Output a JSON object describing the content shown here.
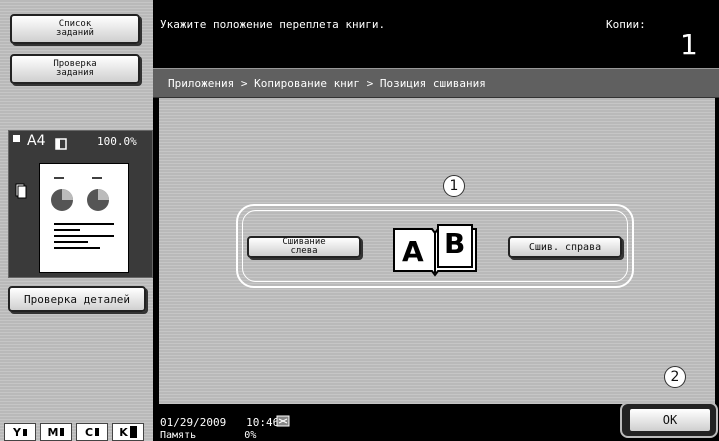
{
  "sidebar": {
    "job_list_label": "Список\nзаданий",
    "job_check_label": "Проверка\nзадания",
    "preview": {
      "paper": "A4",
      "zoom": "100.0%"
    },
    "check_details_label": "Проверка деталей",
    "toner": [
      "Y",
      "M",
      "C",
      "K"
    ],
    "toner_levels": [
      0.3,
      0.4,
      0.35,
      0.8
    ]
  },
  "header": {
    "message": "Укажите положение переплета книги.",
    "copies_label": "Копии:",
    "copies_value": "1"
  },
  "breadcrumb": "Приложения > Копирование книг > Позиция сшивания",
  "options": {
    "left_label": "Сшивание\nслева",
    "right_label": "Сшив. справа",
    "book_left_letter": "A",
    "book_right_letter": "B"
  },
  "callouts": {
    "one": "1",
    "two": "2"
  },
  "status": {
    "date": "01/29/2009",
    "time": "10:46",
    "memory_label": "Память",
    "memory_value": "0%"
  },
  "ok_label": "OK",
  "colors": {
    "panel_gray": "#b9b9b9",
    "breadcrumb_bar": "#606060",
    "background": "#000000"
  }
}
